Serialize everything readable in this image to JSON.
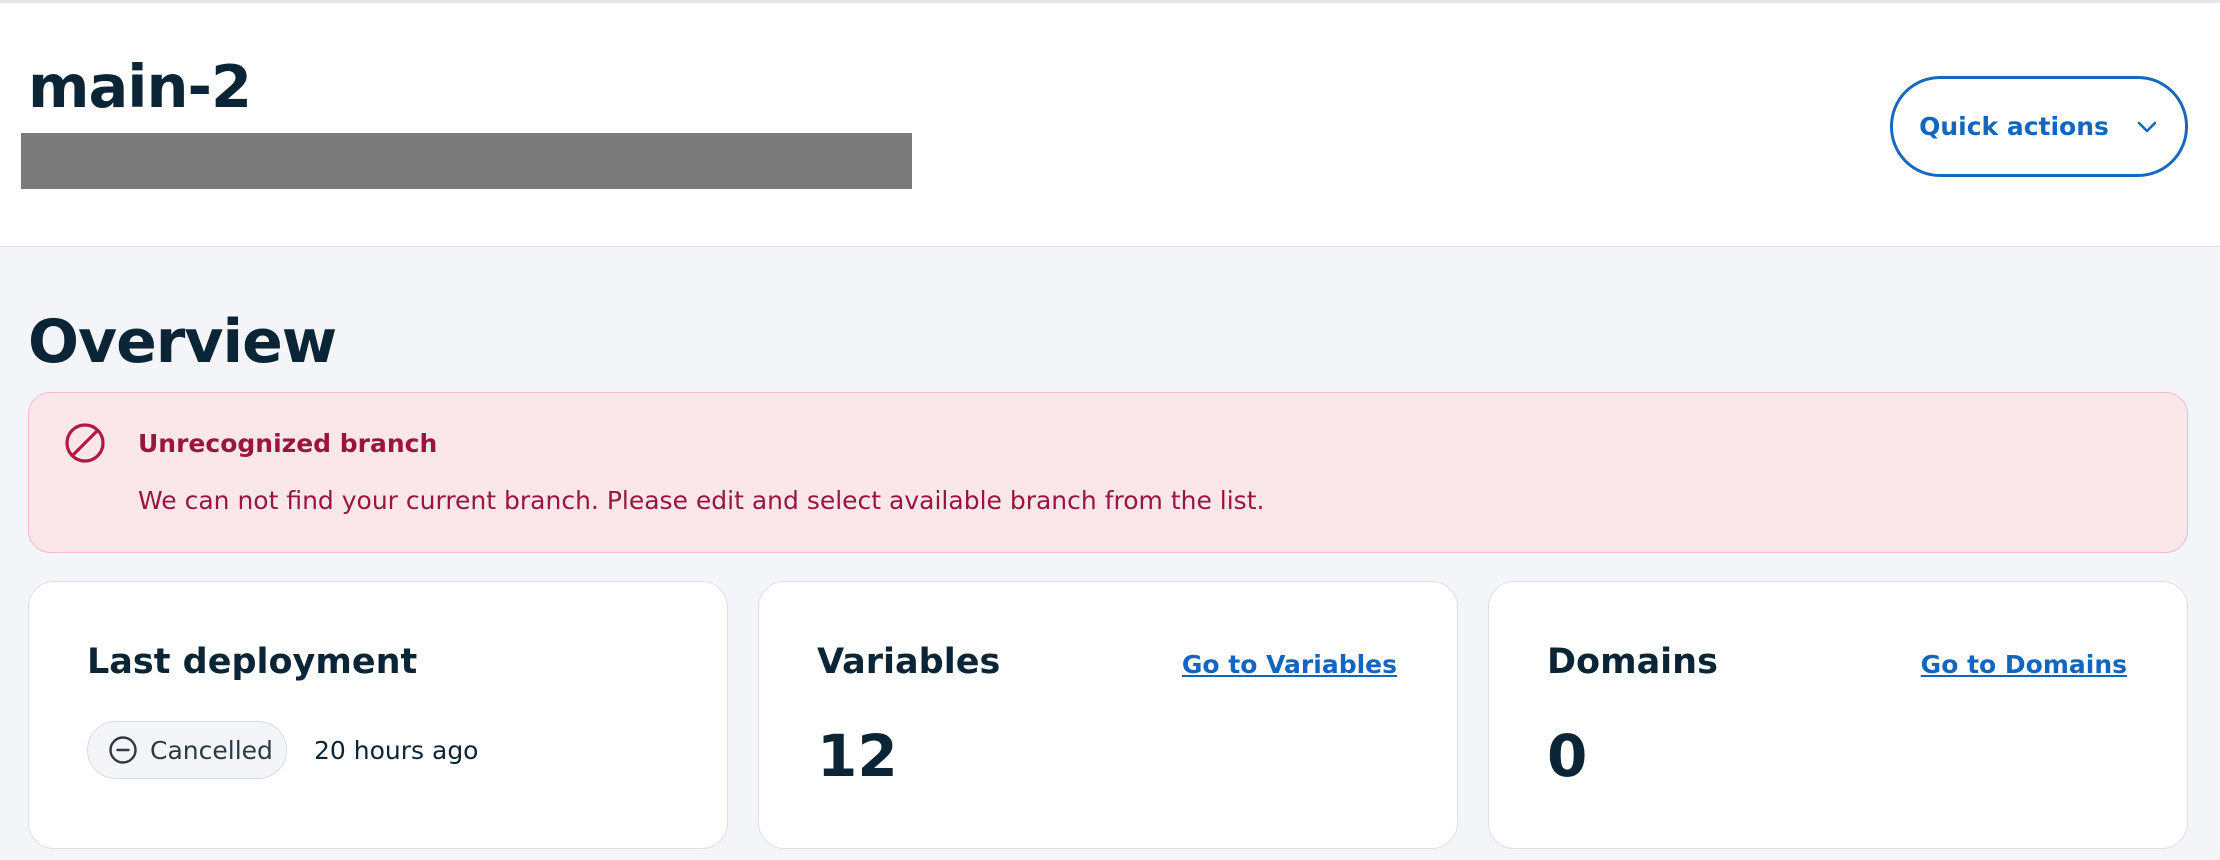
{
  "header": {
    "title": "main-2",
    "quick_actions_label": "Quick actions"
  },
  "overview": {
    "title": "Overview"
  },
  "alert": {
    "title": "Unrecognized branch",
    "message": "We can not find your current branch. Please edit and select available branch from the list."
  },
  "cards": {
    "last_deployment": {
      "title": "Last deployment",
      "status": "Cancelled",
      "time": "20 hours ago"
    },
    "variables": {
      "title": "Variables",
      "link": "Go to Variables",
      "value": "12"
    },
    "domains": {
      "title": "Domains",
      "link": "Go to Domains",
      "value": "0"
    }
  },
  "colors": {
    "brand_blue": "#1366c0",
    "heading_dark": "#0b2537",
    "alert_text": "#9a1440",
    "alert_bg": "#fbe6ea"
  }
}
